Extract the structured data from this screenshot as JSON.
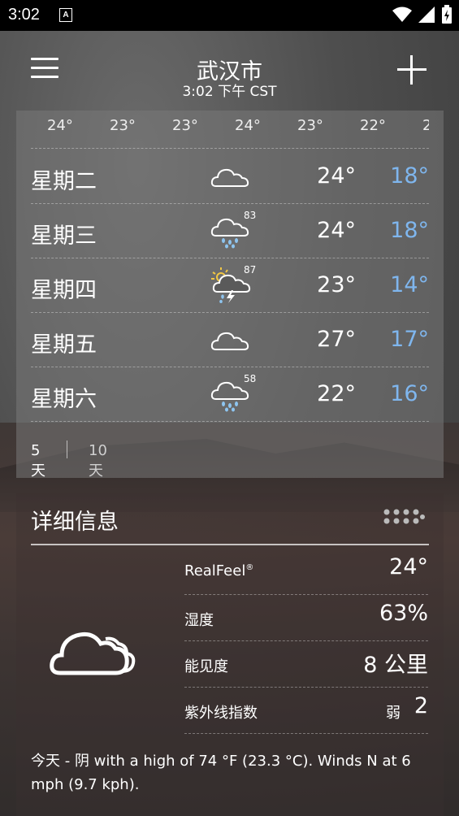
{
  "status_bar": {
    "time": "3:02",
    "sim_label": "A"
  },
  "header": {
    "city": "武汉市",
    "local_time": "3:02 下午 CST"
  },
  "hourly_temps": [
    "24°",
    "23°",
    "23°",
    "24°",
    "23°",
    "22°",
    "2"
  ],
  "daily": [
    {
      "day": "星期二",
      "icon": "cloudy-icon",
      "pop": "",
      "high": "24°",
      "low": "18°"
    },
    {
      "day": "星期三",
      "icon": "rain-icon",
      "pop": "83",
      "high": "24°",
      "low": "18°"
    },
    {
      "day": "星期四",
      "icon": "thunder-sun-icon",
      "pop": "87",
      "high": "23°",
      "low": "14°"
    },
    {
      "day": "星期五",
      "icon": "cloudy-icon",
      "pop": "",
      "high": "27°",
      "low": "17°"
    },
    {
      "day": "星期六",
      "icon": "rain-icon",
      "pop": "58",
      "high": "22°",
      "low": "16°"
    }
  ],
  "range_tabs": {
    "five_day": "5天",
    "ten_day": "10天"
  },
  "details": {
    "title": "详细信息",
    "realfeel_label": "RealFeel",
    "realfeel_mark": "®",
    "realfeel_value": "24°",
    "humidity_label": "湿度",
    "humidity_value": "63%",
    "visibility_label": "能见度",
    "visibility_value": "8 公里",
    "uv_label": "紫外线指数",
    "uv_level": "弱",
    "uv_value": "2",
    "summary": "今天 - 阴 with a high of 74 °F (23.3 °C). Winds N at 6 mph (9.7 kph)."
  },
  "colors": {
    "low_temp": "#7fb6ee",
    "sun": "#f2c744",
    "rain": "#8ec5f0"
  }
}
